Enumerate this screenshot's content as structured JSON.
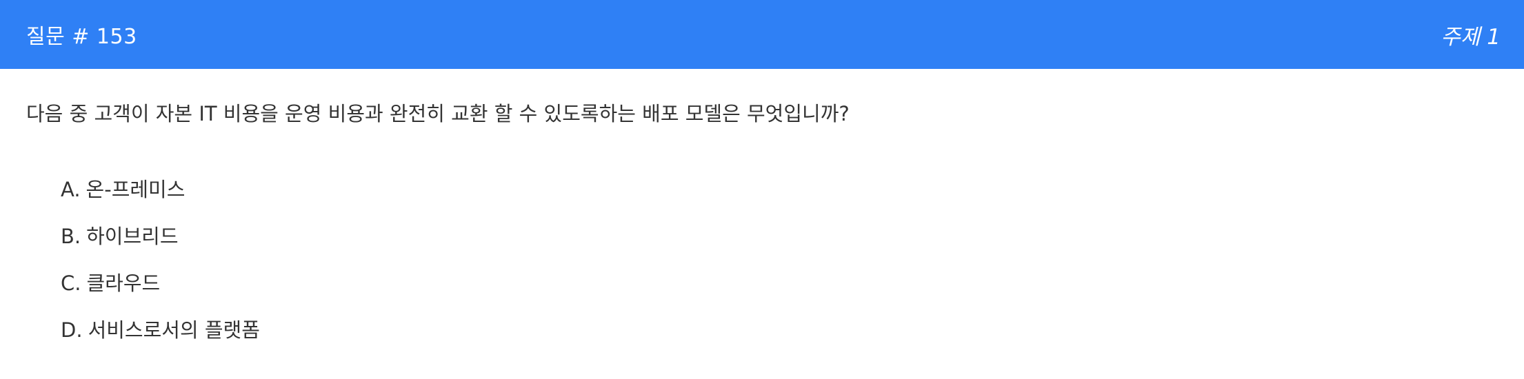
{
  "header": {
    "question_number": "질문 # 153",
    "topic": "주제 1"
  },
  "question": {
    "text": "다음 중 고객이 자본 IT 비용을 운영 비용과 완전히 교환 할 수 있도록하는 배포 모델은 무엇입니까?"
  },
  "options": [
    {
      "letter": "A.",
      "text": "온-프레미스"
    },
    {
      "letter": "B.",
      "text": "하이브리드"
    },
    {
      "letter": "C.",
      "text": "클라우드"
    },
    {
      "letter": "D.",
      "text": "서비스로서의 플랫폼"
    }
  ],
  "colors": {
    "header_bg": "#2f80f5",
    "header_text": "#ffffff",
    "body_text": "#333333"
  }
}
